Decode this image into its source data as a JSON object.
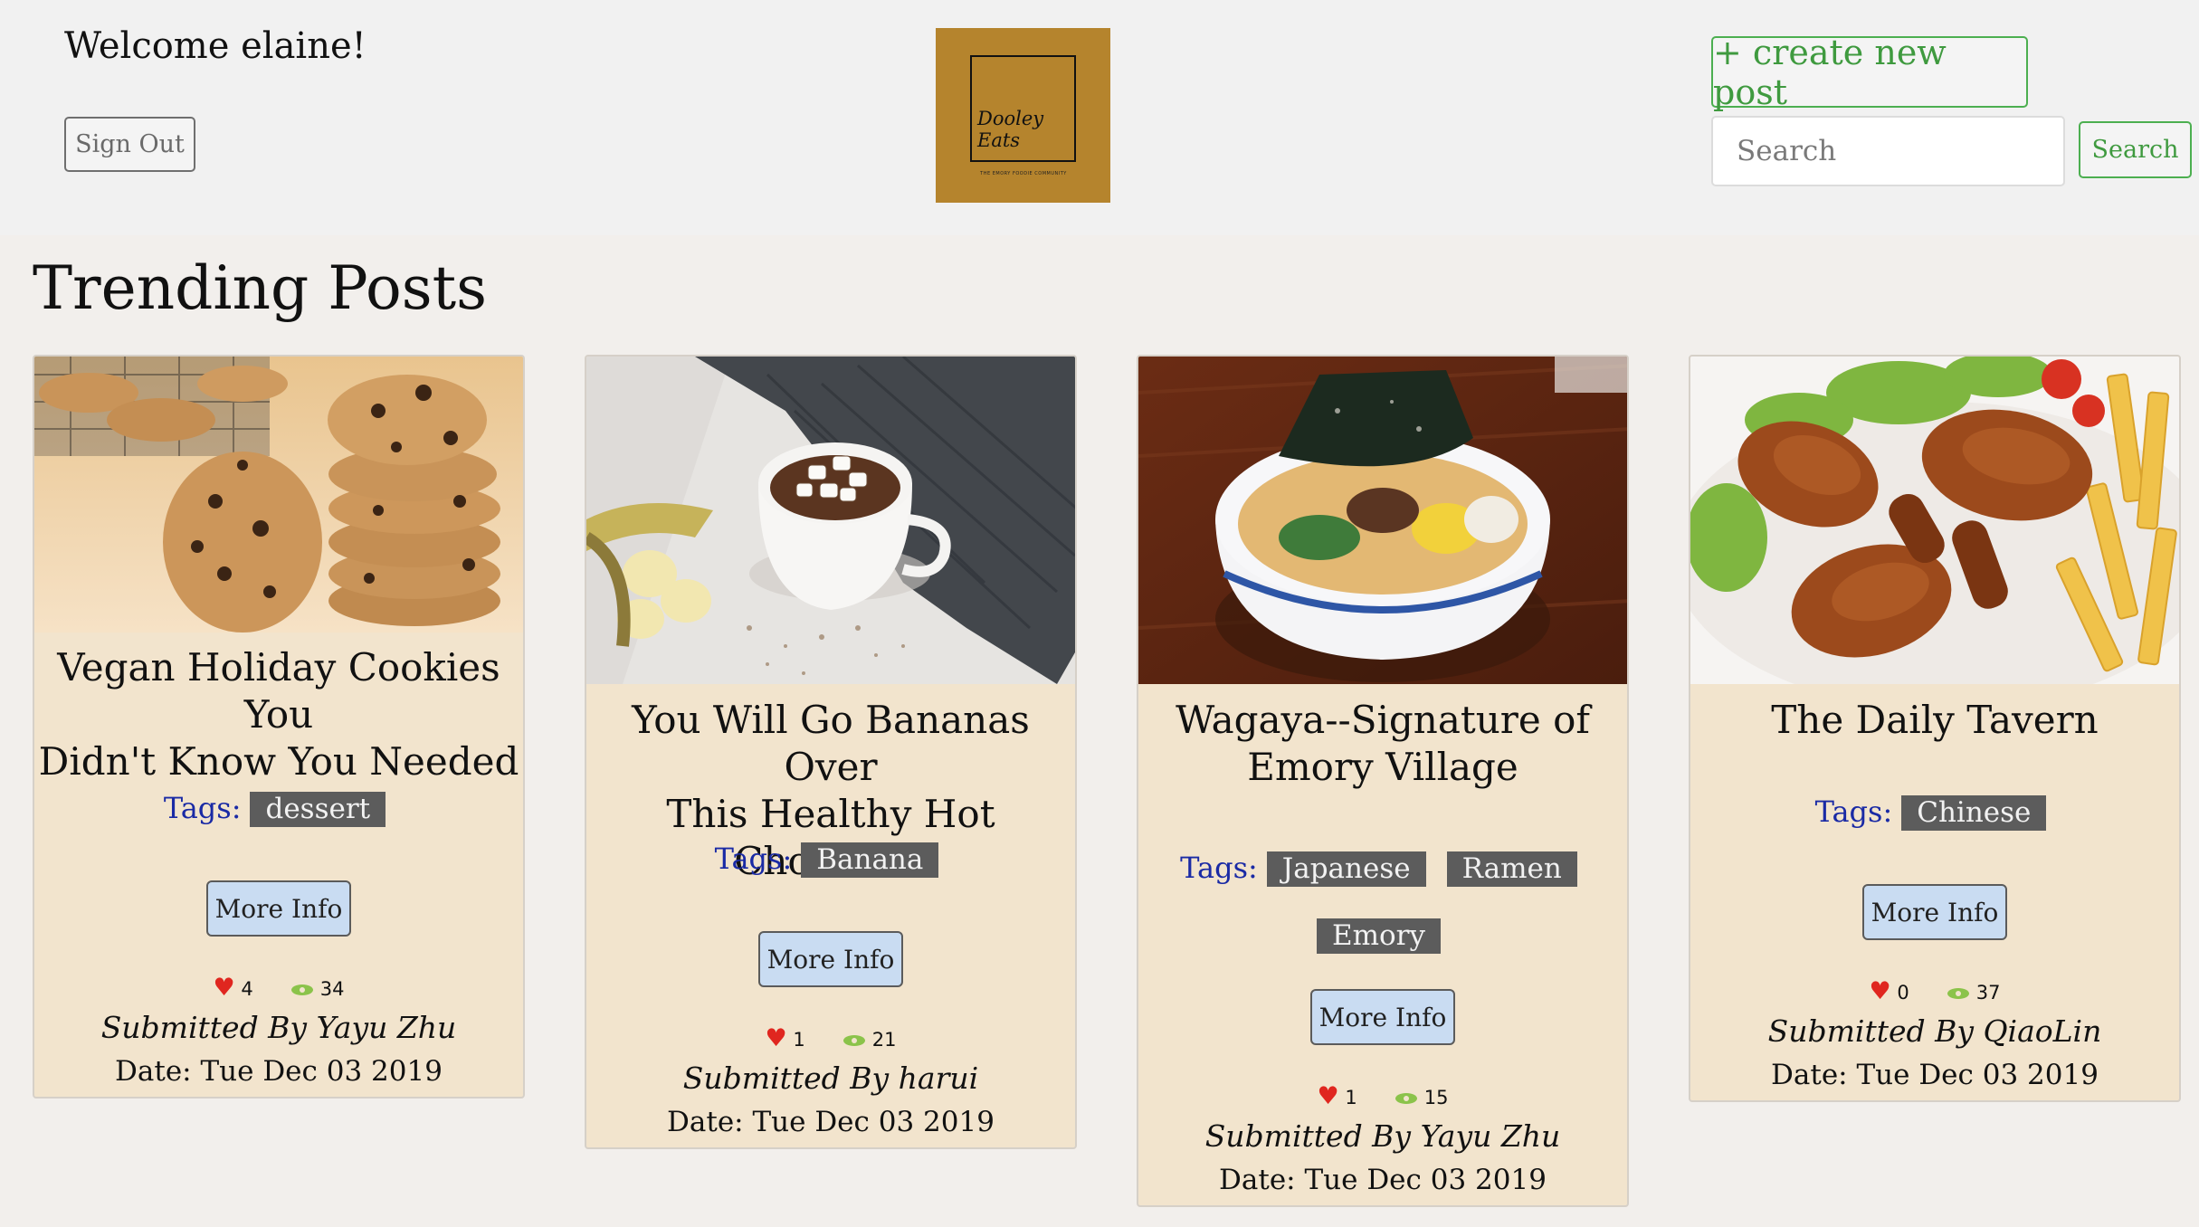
{
  "header": {
    "welcome": "Welcome elaine!",
    "sign_out": "Sign Out",
    "logo_line1": "Dooley",
    "logo_line2": "Eats",
    "logo_tagline": "THE EMORY FOODIE COMMUNITY",
    "create_post": "+ create new post",
    "search_placeholder": "Search",
    "search_button": "Search"
  },
  "main": {
    "section_title": "Trending Posts",
    "tags_label": "Tags:",
    "more_info_label": "More Info",
    "posts": [
      {
        "title_lines": [
          "Vegan Holiday Cookies You",
          "Didn't Know You Needed"
        ],
        "tags": [
          "dessert"
        ],
        "likes": "4",
        "views": "34",
        "submitted": "Submitted By Yayu Zhu",
        "date": "Date: Tue Dec 03 2019",
        "image": "chocolate-chip-cookies-photo"
      },
      {
        "title_lines": [
          "You Will Go Bananas Over",
          "This Healthy Hot Chocolate"
        ],
        "tags": [
          "Banana"
        ],
        "likes": "1",
        "views": "21",
        "submitted": "Submitted By harui",
        "date": "Date: Tue Dec 03 2019",
        "image": "hot-chocolate-banana-photo"
      },
      {
        "title_lines": [
          "Wagaya--Signature of",
          "Emory Village"
        ],
        "tags": [
          "Japanese",
          "Ramen",
          "Emory"
        ],
        "likes": "1",
        "views": "15",
        "submitted": "Submitted By Yayu Zhu",
        "date": "Date: Tue Dec 03 2019",
        "image": "ramen-bowl-photo"
      },
      {
        "title_lines": [
          "The Daily Tavern"
        ],
        "tags": [
          "Chinese"
        ],
        "likes": "0",
        "views": "37",
        "submitted": "Submitted By QiaoLin",
        "date": "Date: Tue Dec 03 2019",
        "image": "roast-chicken-fries-photo"
      }
    ]
  },
  "colors": {
    "accent_green": "#4caf50",
    "card_bg": "#f2e4cd",
    "tag_bg": "#5c5c5c",
    "tags_label": "#1a2aa5",
    "heart": "#e0261f",
    "eye": "#8bc34a",
    "logo_bg": "#b5842d"
  }
}
